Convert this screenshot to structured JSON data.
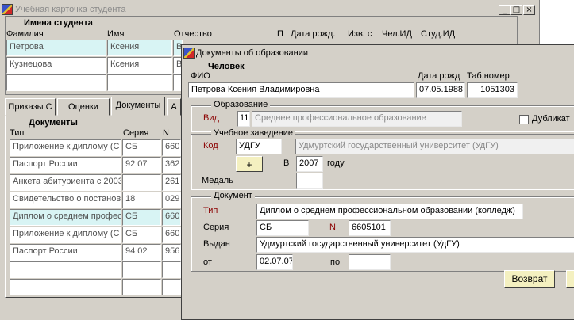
{
  "main_window": {
    "title": "Учебная карточка студента",
    "section_title": "Имена студента",
    "columns": [
      "Фамилия",
      "Имя",
      "Отчество",
      "П",
      "Дата рожд.",
      "Изв. с",
      "Чел.ИД",
      "Студ.ИД"
    ],
    "rows": [
      {
        "surname": "Петрова",
        "name": "Ксения",
        "patronymic": "В"
      },
      {
        "surname": "Кузнецова",
        "name": "Ксения",
        "patronymic": "В"
      },
      {
        "surname": "",
        "name": "",
        "patronymic": ""
      }
    ],
    "tabs": [
      "Приказы С",
      "Оценки",
      "Документы",
      "А"
    ],
    "documents": {
      "title": "Документы",
      "columns": [
        "Тип",
        "Серия",
        "N"
      ],
      "rows": [
        {
          "type": "Приложение к диплому (С",
          "series": "СБ",
          "num": "660"
        },
        {
          "type": "Паспорт России",
          "series": "92 07",
          "num": "362"
        },
        {
          "type": "Анкета абитуриента с 2003",
          "series": "",
          "num": "261"
        },
        {
          "type": "Свидетельство о постанов",
          "series": "18",
          "num": "029"
        },
        {
          "type": "Диплом о среднем профес",
          "series": "СБ",
          "num": "660"
        },
        {
          "type": "Приложение к диплому (С",
          "series": "СБ",
          "num": "660"
        },
        {
          "type": "Паспорт России",
          "series": "94 02",
          "num": "956"
        },
        {
          "type": "",
          "series": "",
          "num": ""
        },
        {
          "type": "",
          "series": "",
          "num": ""
        }
      ]
    }
  },
  "dialog": {
    "title": "Документы об образовании",
    "person_title": "Человек",
    "fio_label": "ФИО",
    "dob_label": "Дата рожд",
    "tab_label": "Таб.номер",
    "fio": "Петрова Ксения Владимировна",
    "dob": "07.05.1988",
    "tab_number": "1051303",
    "education": {
      "group_title": "Образование",
      "vid_label": "Вид",
      "vid_code": "11",
      "vid_text": "Среднее профессиональное образование",
      "duplicate_label": "Дубликат"
    },
    "institution": {
      "group_title": "Учебное заведение",
      "code_label": "Код",
      "code": "УДГУ",
      "name": "Удмуртский государственный университет (УдГУ)",
      "plus_label": "+",
      "year_prefix": "В",
      "year": "2007",
      "year_suffix": "году",
      "medal_label": "Медаль"
    },
    "document": {
      "group_title": "Документ",
      "type_label": "Тип",
      "type": "Диплом о среднем профессиональном образовании (колледж)",
      "series_label": "Серия",
      "series": "СБ",
      "n_label": "N",
      "number": "6605101",
      "issued_label": "Выдан",
      "issued_by": "Удмуртский государственный университет (УдГУ)",
      "from_label": "от",
      "from": "02.07.07",
      "to_label": "по",
      "to": ""
    },
    "return_label": "Возврат"
  },
  "colors": {
    "window_bg": "#d4d0c8",
    "selected_row": "#d8f4f4",
    "button_bg": "#f4f0c0",
    "label_red": "#8b0000"
  }
}
